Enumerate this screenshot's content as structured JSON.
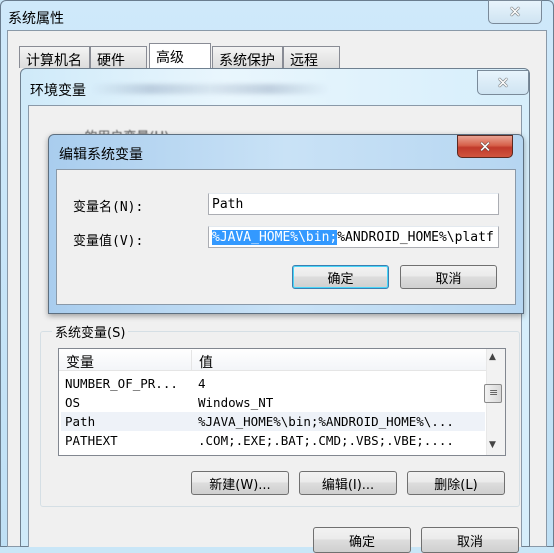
{
  "system_properties": {
    "title": "系统属性",
    "tabs": [
      {
        "label": "计算机名",
        "active": false
      },
      {
        "label": "硬件",
        "active": false
      },
      {
        "label": "高级",
        "active": true
      },
      {
        "label": "系统保护",
        "active": false
      },
      {
        "label": "远程",
        "active": false
      }
    ],
    "close_icon": "close-icon"
  },
  "environment_variables": {
    "title": "环境变量",
    "user_vars_label_obscured": "...的用户变量(U)",
    "close_icon": "close-icon",
    "system_vars": {
      "group_label": "系统变量(S)",
      "columns": [
        "变量",
        "值"
      ],
      "rows": [
        {
          "name": "NUMBER_OF_PR...",
          "value": "4",
          "highlighted": false
        },
        {
          "name": "OS",
          "value": "Windows_NT",
          "highlighted": false
        },
        {
          "name": "Path",
          "value": "%JAVA_HOME%\\bin;%ANDROID_HOME%\\...",
          "highlighted": true
        },
        {
          "name": "PATHEXT",
          "value": ".COM;.EXE;.BAT;.CMD;.VBS;.VBE;....",
          "highlighted": false
        }
      ],
      "buttons": {
        "new": "新建(W)...",
        "edit": "编辑(I)...",
        "delete": "删除(L)"
      }
    },
    "ok": "确定",
    "cancel": "取消"
  },
  "edit_dialog": {
    "title": "编辑系统变量",
    "name_label": "变量名(N):",
    "name_value": "Path",
    "value_label": "变量值(V):",
    "value_selected": "%JAVA_HOME%\\bin;",
    "value_rest": "%ANDROID_HOME%\\platf",
    "ok": "确定",
    "cancel": "取消",
    "close_icon": "close-icon"
  }
}
